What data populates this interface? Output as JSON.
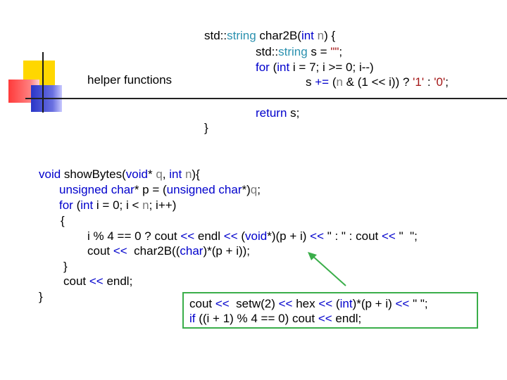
{
  "title": "helper functions",
  "char2B": {
    "l1": {
      "a": "std::",
      "b": "string",
      "c": " char2B(",
      "d": "int",
      "e": " ",
      "f": "n",
      "g": ") {"
    },
    "l2": {
      "a": "std::",
      "b": "string",
      "c": " s = ",
      "d": "\"\"",
      "e": ";"
    },
    "l3": {
      "a": "for",
      "b": " (",
      "c": "int",
      "d": " i = 7; i >= 0; i--)"
    },
    "l4": {
      "a": "s ",
      "b": "+=",
      "c": " (",
      "d": "n",
      "e": " & (1 << i)) ? ",
      "f": "'1'",
      "g": " : ",
      "h": "'0'",
      "i": ";"
    },
    "l5": {
      "a": "return",
      "b": " s;"
    },
    "l6": "}"
  },
  "showBytes": {
    "l1": {
      "a": "void",
      "b": " showBytes(",
      "c": "void",
      "d": "* ",
      "e": "q",
      "f": ", ",
      "g": "int",
      "h": " ",
      "i": "n",
      "j": "){"
    },
    "l2": {
      "a": "unsigned",
      "b": " ",
      "c": "char",
      "d": "* p = (",
      "e": "unsigned",
      "f": " ",
      "g": "char",
      "h": "*)",
      "i": "q",
      "j": ";"
    },
    "l3": {
      "a": "for",
      "b": " (",
      "c": "int",
      "d": " i = 0; i < ",
      "e": "n",
      "f": "; i++)"
    },
    "l4": "{",
    "l5": {
      "a": "i % 4 == 0 ? cout ",
      "b": "<<",
      "c": " endl ",
      "d": "<<",
      "e": " (",
      "f": "void",
      "g": "*)(p + i) ",
      "h": "<<",
      "i": " \" : \" : cout ",
      "j": "<<",
      "k": " \"  \";"
    },
    "l6": {
      "a": "cout ",
      "b": "<<",
      "c": "  char2B((",
      "d": "char",
      "e": ")*(p + i));"
    },
    "l7": "}",
    "l8": {
      "a": "cout ",
      "b": "<<",
      "c": " endl;"
    },
    "l9": "}"
  },
  "box": {
    "l1": {
      "a": "cout ",
      "b": "<<",
      "c": "  setw(2) ",
      "d": "<<",
      "e": " hex ",
      "f": "<<",
      "g": " (",
      "h": "int",
      "i": ")*(p + i) ",
      "j": "<<",
      "k": " \" \";"
    },
    "l2": {
      "a": "if",
      "b": " ((i + 1) % 4 == 0) cout ",
      "c": "<<",
      "d": " endl;"
    }
  },
  "colors": {
    "keyword": "#0000cc",
    "type": "#2b91af",
    "param": "#7a7a7a",
    "string": "#a31515",
    "box_border": "#3aae4a",
    "arrow": "#3aae4a"
  }
}
